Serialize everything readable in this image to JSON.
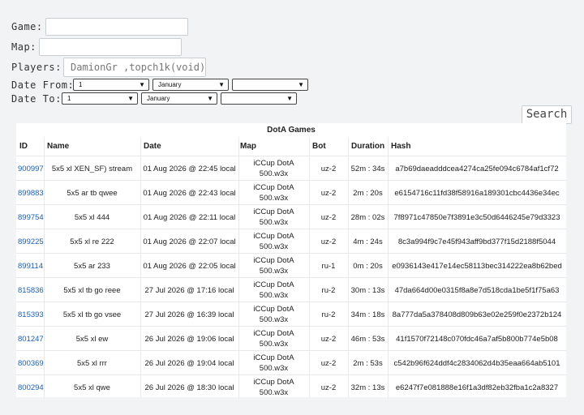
{
  "form": {
    "game_label": "Game:",
    "game_value": "",
    "map_label": "Map:",
    "map_value": "",
    "players_label": "Players:",
    "players_placeholder": "DamionGr ,topch1k(void)",
    "date_from_label": "Date From:",
    "date_from_day": "1",
    "date_from_month": "January",
    "date_from_year": "",
    "date_to_label": "Date To:",
    "date_to_day": "1",
    "date_to_month": "January",
    "date_to_year": "",
    "search_label": "Search"
  },
  "table": {
    "title": "DotA Games",
    "headers": {
      "id": "ID",
      "name": "Name",
      "date": "Date",
      "map": "Map",
      "bot": "Bot",
      "duration": "Duration",
      "hash": "Hash"
    },
    "rows": [
      {
        "id": "900997",
        "name": "5x5 xl XEN_SF) stream",
        "date": "01 Aug 2026 @ 22:45 local",
        "map1": "iCCup DotA",
        "map2": "500.w3x",
        "bot": "uz-2",
        "duration": "52m : 34s",
        "hash": "a7b69daeadddcea4274ca25fe094c6784af1cf72"
      },
      {
        "id": "899883",
        "name": "5x5 ar tb qwee",
        "date": "01 Aug 2026 @ 22:43 local",
        "map1": "iCCup DotA",
        "map2": "500.w3x",
        "bot": "uz-2",
        "duration": "2m : 20s",
        "hash": "e6154716c11fd38f58916a189301cbc4436e34ec"
      },
      {
        "id": "899754",
        "name": "5x5 xl 444",
        "date": "01 Aug 2026 @ 22:11 local",
        "map1": "iCCup DotA",
        "map2": "500.w3x",
        "bot": "uz-2",
        "duration": "28m : 02s",
        "hash": "7f8971c47850e7f3891e3c50d6446245e79d3323"
      },
      {
        "id": "899225",
        "name": "5x5 xl re 222",
        "date": "01 Aug 2026 @ 22:07 local",
        "map1": "iCCup DotA",
        "map2": "500.w3x",
        "bot": "uz-2",
        "duration": "4m : 24s",
        "hash": "8c3a994f9c7e45f943aff9bd377f15d2188f5044"
      },
      {
        "id": "899114",
        "name": "5x5 ar 233",
        "date": "01 Aug 2026 @ 22:05 local",
        "map1": "iCCup DotA",
        "map2": "500.w3x",
        "bot": "ru-1",
        "duration": "0m : 20s",
        "hash": "e0936143e417e14ec58113bec314222ea8b62bed"
      },
      {
        "id": "815836",
        "name": "5x5 xl tb go reee",
        "date": "27 Jul 2026 @ 17:16 local",
        "map1": "iCCup DotA",
        "map2": "500.w3x",
        "bot": "ru-2",
        "duration": "30m : 13s",
        "hash": "47da664d00e0315f8a8e7d518cda1be5f1f75a63"
      },
      {
        "id": "815393",
        "name": "5x5 xl tb go vsee",
        "date": "27 Jul 2026 @ 16:39 local",
        "map1": "iCCup DotA",
        "map2": "500.w3x",
        "bot": "ru-2",
        "duration": "34m : 18s",
        "hash": "8a777da5a378408d809b63e02e259f0e2372b124"
      },
      {
        "id": "801247",
        "name": "5x5 xl ew",
        "date": "26 Jul 2026 @ 19:06 local",
        "map1": "iCCup DotA",
        "map2": "500.w3x",
        "bot": "uz-2",
        "duration": "46m : 53s",
        "hash": "41f1570f72148c070fdc46a7af5b800b774e5b08"
      },
      {
        "id": "800369",
        "name": "5x5 xl rrr",
        "date": "26 Jul 2026 @ 19:04 local",
        "map1": "iCCup DotA",
        "map2": "500.w3x",
        "bot": "uz-2",
        "duration": "2m : 53s",
        "hash": "c542b96f624ddf4c2834062d4b35eaa664ab5101"
      },
      {
        "id": "800294",
        "name": "5x5 xl qwe",
        "date": "26 Jul 2026 @ 18:30 local",
        "map1": "iCCup DotA",
        "map2": "500.w3x",
        "bot": "uz-2",
        "duration": "32m : 13s",
        "hash": "e6247f7e081888e16f1a3df82eb32fba1c2a8327"
      }
    ]
  }
}
